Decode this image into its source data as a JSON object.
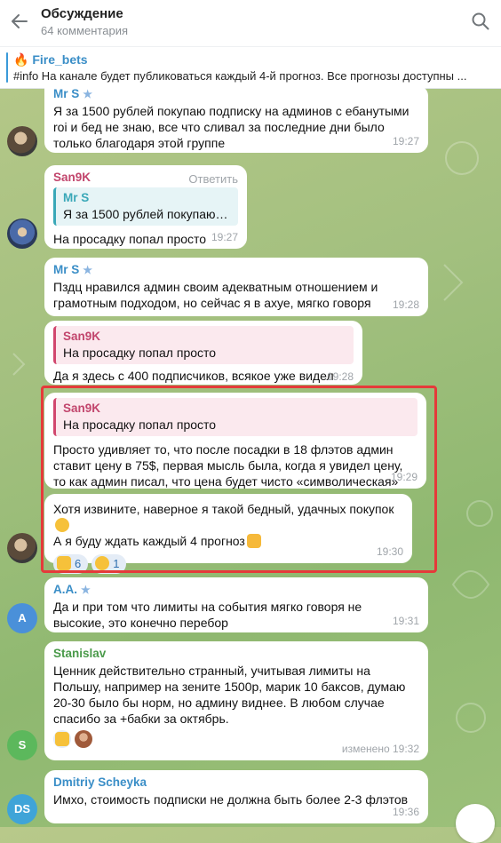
{
  "header": {
    "title": "Обсуждение",
    "subtitle": "64 комментария"
  },
  "pinned": {
    "channel": "Fire_bets",
    "text": "#info На канале будет публиковаться каждый 4-й прогноз.  Все прогнозы доступны ..."
  },
  "messages": [
    {
      "author": "Mr S",
      "text": "Я за 1500 рублей покупаю подписку на админов с ебанутыми roi и бед не знаю, все что сливал за последние дни было только благодаря этой группе",
      "time": "19:27"
    },
    {
      "author": "San9K",
      "reply_action": "Ответить",
      "quote_author": "Mr S",
      "quote_text": "Я за 1500 рублей покупаю по...",
      "text": "На просадку попал просто",
      "time": "19:27"
    },
    {
      "author": "Mr S",
      "text": "Пздц нравился админ своим адекватным отношением и грамотным подходом, но сейчас я в ахуе, мягко говоря",
      "time": "19:28"
    },
    {
      "quote_author": "San9K",
      "quote_text": "На просадку попал просто",
      "text": "Да я здесь с 400 подписчиков, всякое уже видел",
      "time": "19:28"
    },
    {
      "quote_author": "San9K",
      "quote_text": "На просадку попал просто",
      "text": "Просто удивляет то, что после посадки в 18 флэтов админ ставит цену в 75$, первая мысль была, когда я увидел цену, то как админ писал, что цена будет чисто «символическая»",
      "time": "19:29"
    },
    {
      "text_line1": "Хотя извините, наверное я такой бедный, удачных покупок",
      "text_line2": "А я буду ждать каждый 4 прогноз",
      "reactions": [
        {
          "emoji": "thumbs-up",
          "count": "6"
        },
        {
          "emoji": "grin",
          "count": "1"
        }
      ],
      "time": "19:30"
    },
    {
      "author": "A.A.",
      "avatar_text": "A",
      "text": "Да и при том что лимиты на события мягко говоря не высокие, это конечно перебор",
      "time": "19:31"
    },
    {
      "author": "Stanislav",
      "avatar_text": "S",
      "text": "Ценник действительно странный, учитывая лимиты на Польшу, например на зените 1500р, марик 10 баксов, думаю 20-30 было бы норм, но админу виднее. В любом случае спасибо за +бабки за октябрь.",
      "time": "изменено 19:32"
    },
    {
      "author": "Dmitriy Scheyka",
      "avatar_text": "DS",
      "text": "Имхо, стоимость подписки не должна быть более 2-3 флэтов",
      "time": "19:36"
    }
  ],
  "colors": {
    "mr_s": "#3a8ec7",
    "san9k": "#c2466d",
    "aa": "#3a8ec7",
    "stanislav": "#4a9a4a",
    "dmitriy": "#3a8ec7",
    "highlight": "#e53a3a",
    "avatar_a": "#4a90d9",
    "avatar_s": "#5cb85c",
    "avatar_ds": "#3fa4d8"
  }
}
